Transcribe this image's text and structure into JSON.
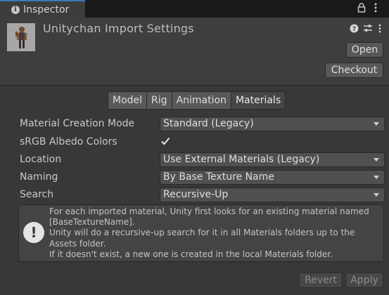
{
  "tab": {
    "label": "Inspector",
    "icon": "info-icon"
  },
  "tab_controls": {
    "lock_icon": "lock-icon",
    "menu_icon": "kebab-menu-icon"
  },
  "header": {
    "title": "Unitychan Import Settings",
    "open_label": "Open",
    "checkout_label": "Checkout",
    "icons": [
      "help-icon",
      "preset-icon",
      "settings-menu-icon"
    ]
  },
  "tabs": [
    {
      "label": "Model",
      "selected": false
    },
    {
      "label": "Rig",
      "selected": false
    },
    {
      "label": "Animation",
      "selected": false
    },
    {
      "label": "Materials",
      "selected": true
    }
  ],
  "fields": {
    "creation_mode": {
      "label": "Material Creation Mode",
      "value": "Standard (Legacy)"
    },
    "srgb": {
      "label": "sRGB Albedo Colors",
      "checked": true
    },
    "location": {
      "label": "Location",
      "value": "Use External Materials (Legacy)"
    },
    "naming": {
      "label": "Naming",
      "value": "By Base Texture Name"
    },
    "search": {
      "label": "Search",
      "value": "Recursive-Up"
    }
  },
  "help": {
    "icon": "info-exclamation-icon",
    "lines": [
      "For each imported material, Unity first looks for an existing material named",
      "[BaseTextureName].",
      "Unity will do a recursive-up search for it in all Materials folders up to the",
      "Assets folder.",
      "If it doesn't exist, a new one is created in the local Materials folder."
    ]
  },
  "footer": {
    "revert_label": "Revert",
    "apply_label": "Apply"
  },
  "colors": {
    "background": "#383838",
    "tab_accent": "#3a79bb"
  }
}
